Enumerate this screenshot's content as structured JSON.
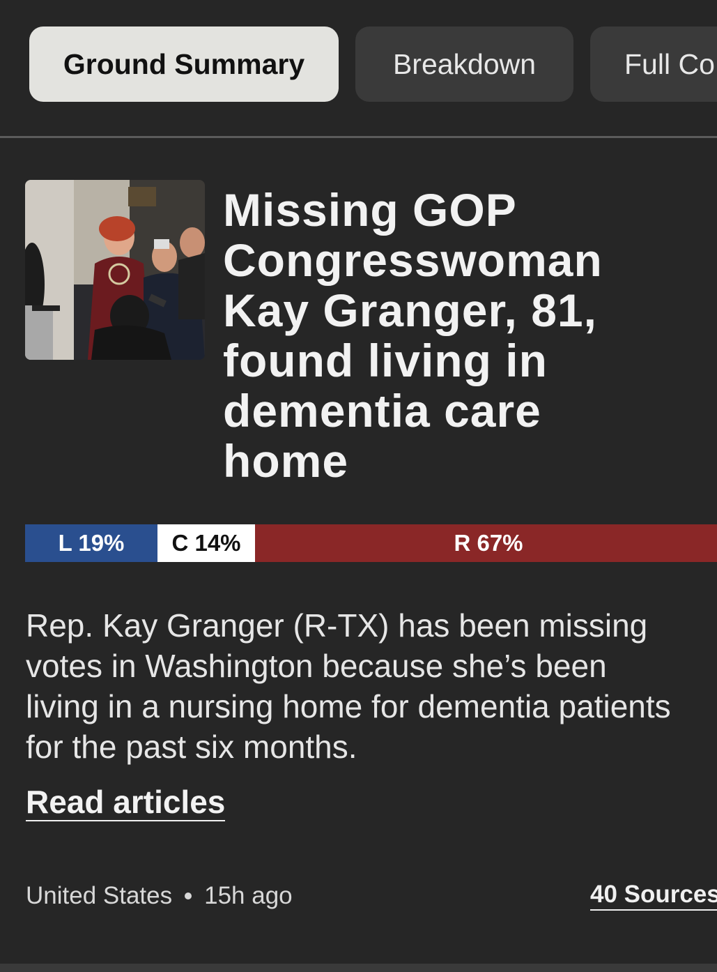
{
  "tabs": [
    {
      "label": "Ground Summary",
      "active": true
    },
    {
      "label": "Breakdown",
      "active": false
    },
    {
      "label": "Full Co",
      "active": false
    }
  ],
  "story": {
    "image_alt": "Kay Granger surrounded by reporters",
    "headline": "Missing GOP Congresswoman Kay Granger, 81, found living in dementia care home",
    "bias": {
      "left": {
        "label": "L 19%",
        "percent": 19,
        "color": "#2a4f8f"
      },
      "center": {
        "label": "C 14%",
        "percent": 14,
        "color": "#ffffff"
      },
      "right": {
        "label": "R 67%",
        "percent": 67,
        "color": "#8a2727"
      }
    },
    "summary_lines": [
      "Rep. Kay Granger (R-TX) has been missing",
      "votes in Washington because she’s been",
      "living in a nursing home for dementia patients",
      "for the past six months."
    ],
    "read_link": "Read articles",
    "location": "United States",
    "time": "15h ago",
    "sources": "40 Sources"
  }
}
